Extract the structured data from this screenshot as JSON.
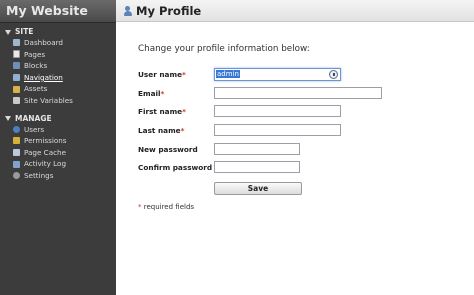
{
  "sidebar": {
    "site_title": "My Website",
    "sections": [
      {
        "title": "SITE",
        "items": [
          {
            "label": "Dashboard",
            "icon": "dashboard-icon"
          },
          {
            "label": "Pages",
            "icon": "pages-icon"
          },
          {
            "label": "Blocks",
            "icon": "blocks-icon"
          },
          {
            "label": "Navigation",
            "icon": "navigation-icon",
            "active": true
          },
          {
            "label": "Assets",
            "icon": "assets-icon"
          },
          {
            "label": "Site Variables",
            "icon": "variables-icon"
          }
        ]
      },
      {
        "title": "MANAGE",
        "items": [
          {
            "label": "Users",
            "icon": "users-icon"
          },
          {
            "label": "Permissions",
            "icon": "key-icon"
          },
          {
            "label": "Page Cache",
            "icon": "cache-icon"
          },
          {
            "label": "Activity Log",
            "icon": "log-icon"
          },
          {
            "label": "Settings",
            "icon": "gear-icon"
          }
        ]
      }
    ]
  },
  "header": {
    "title": "My Profile",
    "icon": "user-profile-icon"
  },
  "form": {
    "intro": "Change your profile information below:",
    "fields": {
      "username": {
        "label": "User name",
        "required_mark": "*",
        "value": "admin"
      },
      "email": {
        "label": "Email",
        "required_mark": "*",
        "value": ""
      },
      "first_name": {
        "label": "First name",
        "required_mark": "*",
        "value": ""
      },
      "last_name": {
        "label": "Last name",
        "required_mark": "*",
        "value": ""
      },
      "new_password": {
        "label": "New password",
        "value": ""
      },
      "confirm_password": {
        "label": "Confirm password",
        "value": ""
      }
    },
    "save_label": "Save",
    "required_note_mark": "*",
    "required_note": " required fields"
  },
  "colors": {
    "sidebar_bg": "#3c3c3c",
    "required": "#c0392b",
    "selection": "#3778d6"
  }
}
